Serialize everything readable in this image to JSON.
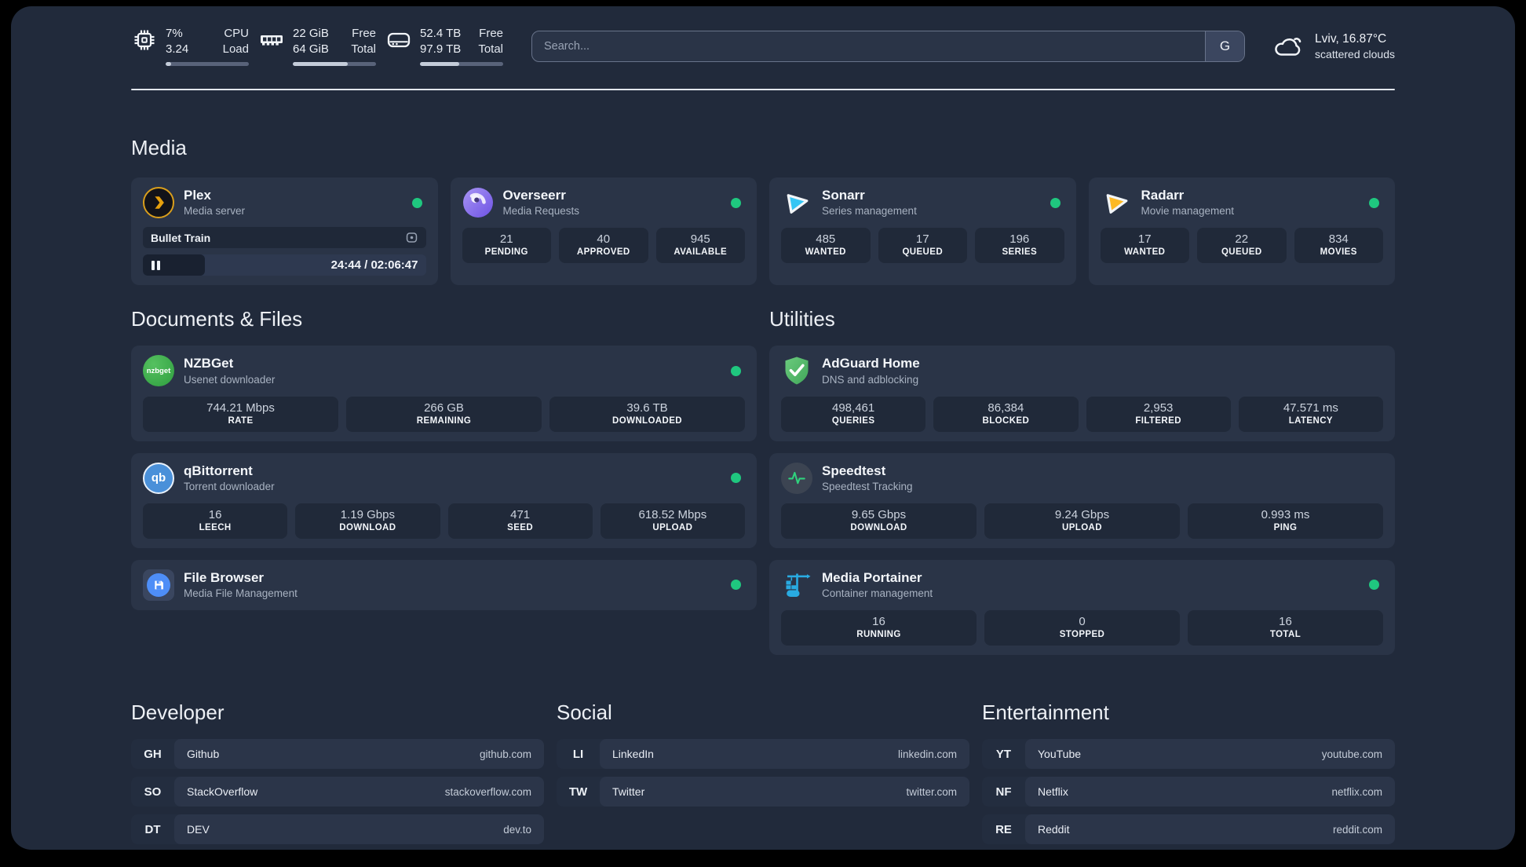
{
  "theme": {
    "panel_bg": "#212a3b",
    "card_bg": "#2a3447",
    "stat_bg": "#202939",
    "online_green": "#1fc77f",
    "plex_orange": "#e5a00d",
    "sonarr_blue": "#35c5f4",
    "radarr_yellow": "#fdb924",
    "adguard_green": "#55bd6c",
    "portainer_blue": "#29abe2"
  },
  "header": {
    "metrics": [
      {
        "icon": "cpu-icon",
        "value1": "7%",
        "value2": "3.24",
        "label1": "CPU",
        "label2": "Load",
        "progress_pct": 7
      },
      {
        "icon": "ram-icon",
        "value1": "22 GiB",
        "value2": "64 GiB",
        "label1": "Free",
        "label2": "Total",
        "progress_pct": 66
      },
      {
        "icon": "disk-icon",
        "value1": "52.4 TB",
        "value2": "97.9 TB",
        "label1": "Free",
        "label2": "Total",
        "progress_pct": 47
      }
    ],
    "search": {
      "placeholder": "Search...",
      "button_label": "G"
    },
    "weather": {
      "icon": "cloud-icon",
      "location_temp": "Lviv, 16.87°C",
      "condition": "scattered clouds"
    }
  },
  "media": {
    "title": "Media",
    "cards": [
      {
        "icon": "plex-icon",
        "title": "Plex",
        "subtitle": "Media server",
        "online": true,
        "player": {
          "track": "Bullet Train",
          "time": "24:44 / 02:06:47",
          "progress_pct": 22,
          "state": "paused"
        }
      },
      {
        "icon": "overseerr-icon",
        "title": "Overseerr",
        "subtitle": "Media Requests",
        "online": true,
        "stats": [
          {
            "value": "21",
            "label": "PENDING"
          },
          {
            "value": "40",
            "label": "APPROVED"
          },
          {
            "value": "945",
            "label": "AVAILABLE"
          }
        ]
      },
      {
        "icon": "sonarr-icon",
        "title": "Sonarr",
        "subtitle": "Series management",
        "online": true,
        "stats": [
          {
            "value": "485",
            "label": "WANTED"
          },
          {
            "value": "17",
            "label": "QUEUED"
          },
          {
            "value": "196",
            "label": "SERIES"
          }
        ]
      },
      {
        "icon": "radarr-icon",
        "title": "Radarr",
        "subtitle": "Movie management",
        "online": true,
        "stats": [
          {
            "value": "17",
            "label": "WANTED"
          },
          {
            "value": "22",
            "label": "QUEUED"
          },
          {
            "value": "834",
            "label": "MOVIES"
          }
        ]
      }
    ]
  },
  "documents": {
    "title": "Documents & Files",
    "cards": [
      {
        "icon": "nzbget-icon",
        "icon_text": "nzbget",
        "title": "NZBGet",
        "subtitle": "Usenet downloader",
        "online": true,
        "stats": [
          {
            "value": "744.21 Mbps",
            "label": "RATE"
          },
          {
            "value": "266 GB",
            "label": "REMAINING"
          },
          {
            "value": "39.6 TB",
            "label": "DOWNLOADED"
          }
        ]
      },
      {
        "icon": "qbittorrent-icon",
        "icon_text": "qb",
        "title": "qBittorrent",
        "subtitle": "Torrent downloader",
        "online": true,
        "stats": [
          {
            "value": "16",
            "label": "LEECH"
          },
          {
            "value": "1.19 Gbps",
            "label": "DOWNLOAD"
          },
          {
            "value": "471",
            "label": "SEED"
          },
          {
            "value": "618.52 Mbps",
            "label": "UPLOAD"
          }
        ]
      },
      {
        "icon": "filebrowser-icon",
        "title": "File Browser",
        "subtitle": "Media File Management",
        "online": true
      }
    ]
  },
  "utilities": {
    "title": "Utilities",
    "cards": [
      {
        "icon": "adguard-icon",
        "title": "AdGuard Home",
        "subtitle": "DNS and adblocking",
        "stats": [
          {
            "value": "498,461",
            "label": "QUERIES"
          },
          {
            "value": "86,384",
            "label": "BLOCKED"
          },
          {
            "value": "2,953",
            "label": "FILTERED"
          },
          {
            "value": "47.571 ms",
            "label": "LATENCY"
          }
        ]
      },
      {
        "icon": "speedtest-icon",
        "title": "Speedtest",
        "subtitle": "Speedtest Tracking",
        "stats": [
          {
            "value": "9.65 Gbps",
            "label": "DOWNLOAD"
          },
          {
            "value": "9.24 Gbps",
            "label": "UPLOAD"
          },
          {
            "value": "0.993 ms",
            "label": "PING"
          }
        ]
      },
      {
        "icon": "portainer-icon",
        "title": "Media Portainer",
        "subtitle": "Container management",
        "online": true,
        "stats": [
          {
            "value": "16",
            "label": "RUNNING"
          },
          {
            "value": "0",
            "label": "STOPPED"
          },
          {
            "value": "16",
            "label": "TOTAL"
          }
        ]
      }
    ]
  },
  "links": {
    "developer": {
      "title": "Developer",
      "items": [
        {
          "abbr": "GH",
          "name": "Github",
          "url": "github.com"
        },
        {
          "abbr": "SO",
          "name": "StackOverflow",
          "url": "stackoverflow.com"
        },
        {
          "abbr": "DT",
          "name": "DEV",
          "url": "dev.to"
        }
      ]
    },
    "social": {
      "title": "Social",
      "items": [
        {
          "abbr": "LI",
          "name": "LinkedIn",
          "url": "linkedin.com"
        },
        {
          "abbr": "TW",
          "name": "Twitter",
          "url": "twitter.com"
        }
      ]
    },
    "entertainment": {
      "title": "Entertainment",
      "items": [
        {
          "abbr": "YT",
          "name": "YouTube",
          "url": "youtube.com"
        },
        {
          "abbr": "NF",
          "name": "Netflix",
          "url": "netflix.com"
        },
        {
          "abbr": "RE",
          "name": "Reddit",
          "url": "reddit.com"
        }
      ]
    }
  }
}
